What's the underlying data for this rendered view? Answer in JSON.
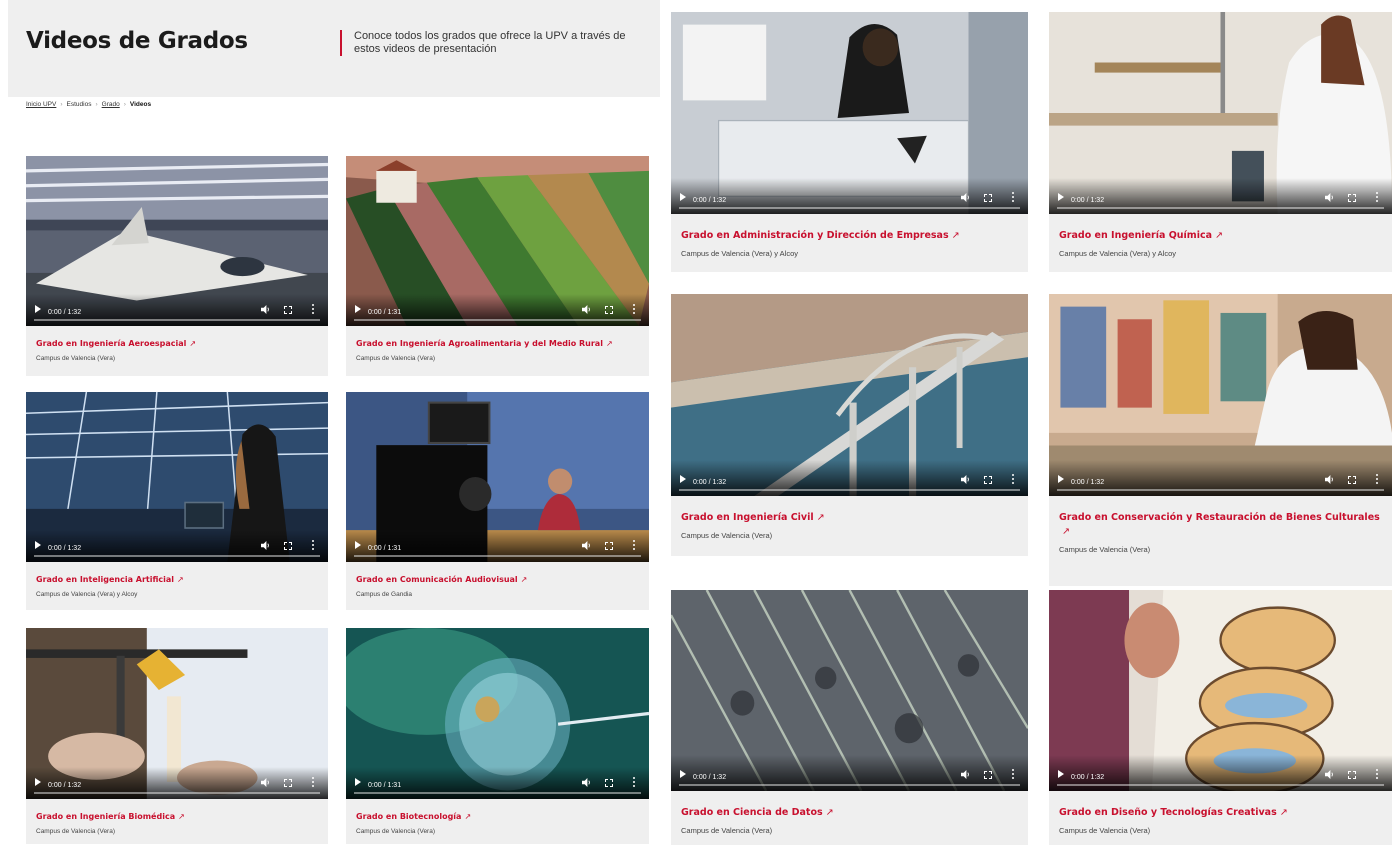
{
  "header": {
    "title": "Videos de Grados",
    "description": "Conoce todos los grados que ofrece la UPV a través de estos videos de presentación"
  },
  "breadcrumb": [
    "Inicio UPV",
    "Estudios",
    "Grado",
    "Videos"
  ],
  "colors": {
    "accent": "#c8102e",
    "panel": "#efefef",
    "text": "#222222"
  },
  "cards": [
    {
      "title": "Grado en Ingeniería Aeroespacial",
      "campus": "Campus de Valencia (Vera)",
      "time": "0:00 / 1:32",
      "thumbnail": "aircraft-hangar"
    },
    {
      "title": "Grado en Ingeniería Agroalimentaria y del Medio Rural",
      "campus": "Campus de Valencia (Vera)",
      "time": "0:00 / 1:31",
      "thumbnail": "crop-fields"
    },
    {
      "title": "Grado en Inteligencia Artificial",
      "campus": "Campus de Valencia (Vera) y Alcoy",
      "time": "0:00 / 1:32",
      "thumbnail": "laptop-office"
    },
    {
      "title": "Grado en Comunicación Audiovisual",
      "campus": "Campus de Gandia",
      "time": "0:00 / 1:31",
      "thumbnail": "tv-studio"
    },
    {
      "title": "Grado en Ingeniería Biomédica",
      "campus": "Campus de Valencia (Vera)",
      "time": "0:00 / 1:32",
      "thumbnail": "lab-3d-printer"
    },
    {
      "title": "Grado en Biotecnología",
      "campus": "Campus de Valencia (Vera)",
      "time": "0:00 / 1:31",
      "thumbnail": "cell-microscopy"
    },
    {
      "title": "Grado en Administración y Dirección de Empresas",
      "campus": "Campus de Valencia (Vera) y Alcoy",
      "time": "0:00 / 1:32",
      "thumbnail": "desk-overhead"
    },
    {
      "title": "Grado en Ingeniería Química",
      "campus": "Campus de Valencia (Vera) y Alcoy",
      "time": "0:00 / 1:32",
      "thumbnail": "chemistry-lab"
    },
    {
      "title": "Grado en Ingeniería Civil",
      "campus": "Campus de Valencia (Vera)",
      "time": "0:00 / 1:32",
      "thumbnail": "railway-viaduct"
    },
    {
      "title": "Grado en Conservación y Restauración de Bienes Culturales",
      "campus": "Campus de Valencia (Vera)",
      "time": "0:00 / 1:32",
      "thumbnail": "painting-restoration"
    },
    {
      "title": "Grado en Ciencia de Datos",
      "campus": "Campus de Valencia (Vera)",
      "time": "0:00 / 1:32",
      "thumbnail": "data-crowd"
    },
    {
      "title": "Grado en Diseño y Tecnologías Creativas",
      "campus": "Campus de Valencia (Vera)",
      "time": "0:00 / 1:32",
      "thumbnail": "illustration-drawing"
    }
  ],
  "icons": {
    "play": "play-icon",
    "volume": "volume-icon",
    "fullscreen": "fullscreen-icon",
    "more": "more-options-icon",
    "external": "external-link-icon"
  },
  "external_glyph": "↗"
}
